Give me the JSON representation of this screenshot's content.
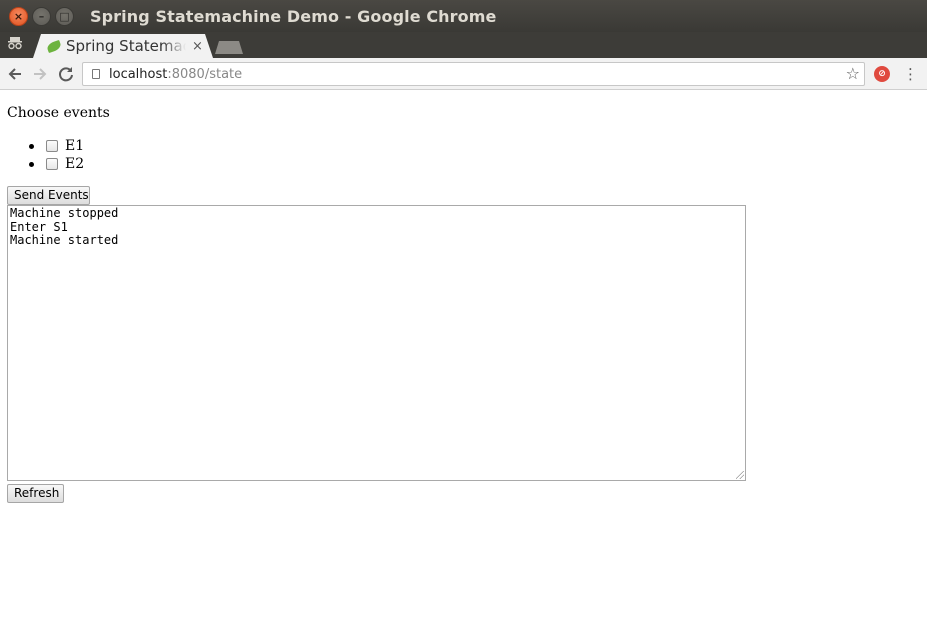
{
  "window": {
    "title": "Spring Statemachine Demo - Google Chrome",
    "buttons": {
      "close": "×",
      "minimize": "–",
      "maximize": "□"
    }
  },
  "tabs": [
    {
      "title": "Spring Statemachine Demo",
      "favicon": "spring-leaf-icon",
      "close_glyph": "×"
    }
  ],
  "toolbar": {
    "url_host": "localhost",
    "url_rest": ":8080/state",
    "icons": [
      "back-icon",
      "forward-icon",
      "reload-icon",
      "page-icon",
      "star-icon",
      "extension-icon",
      "menu-icon"
    ]
  },
  "page": {
    "heading": "Choose events",
    "events": [
      {
        "label": "E1",
        "checked": false
      },
      {
        "label": "E2",
        "checked": false
      }
    ],
    "send_button": "Send Events",
    "log_lines": [
      "Machine stopped",
      "Enter S1",
      "Machine started"
    ],
    "refresh_button": "Refresh"
  },
  "colors": {
    "titlebar": "#3a3935",
    "close_button": "#e0501d",
    "favicon": "#6db33f",
    "extension": "#e04a3f"
  }
}
